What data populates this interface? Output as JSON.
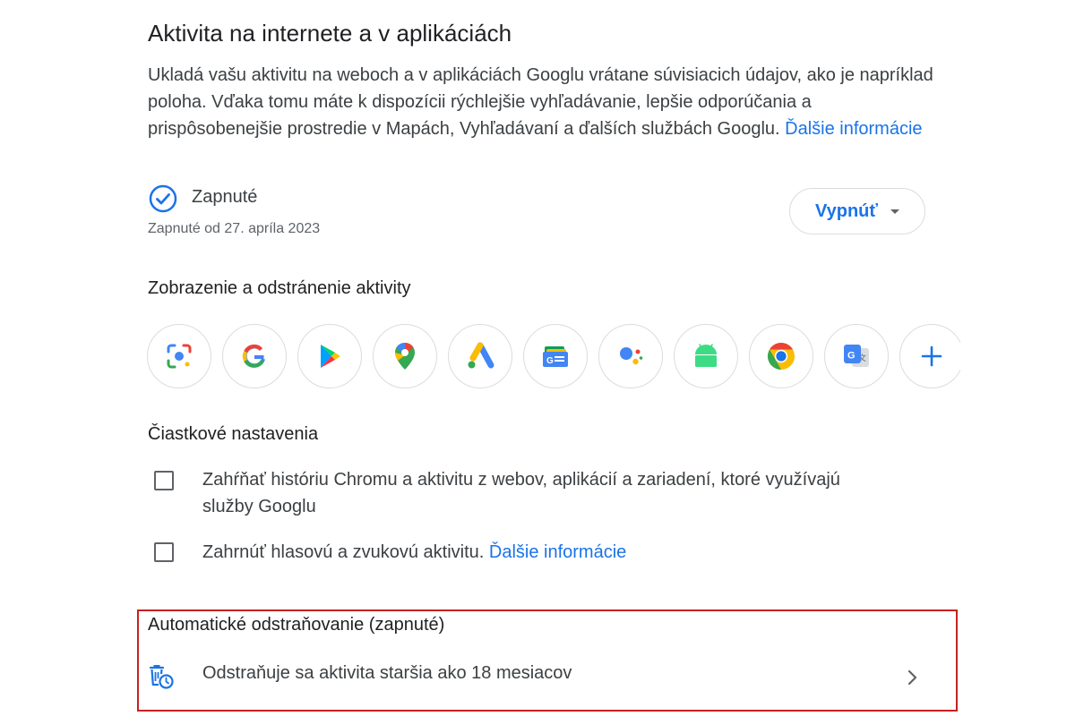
{
  "section": {
    "title": "Aktivita na internete a v aplikáciách",
    "description": "Ukladá vašu aktivitu na weboch a v aplikáciách Googlu vrátane súvisiacich údajov, ako je napríklad poloha. Vďaka tomu máte k dispozícii rýchlejšie vyhľadávanie, lepšie odporúčania a prispôsobenejšie prostredie v Mapách, Vyhľadávaní a ďalších službách Googlu.",
    "learn_more": "Ďalšie informácie"
  },
  "status": {
    "label": "Zapnuté",
    "since": "Zapnuté od 27. apríla 2023",
    "icon": "check-circle-icon",
    "toggle_label": "Vypnúť"
  },
  "activity": {
    "heading": "Zobrazenie a odstránenie aktivity",
    "apps": [
      {
        "name": "google-lens-icon"
      },
      {
        "name": "google-search-icon"
      },
      {
        "name": "google-play-icon"
      },
      {
        "name": "google-maps-icon"
      },
      {
        "name": "google-ads-icon"
      },
      {
        "name": "google-news-icon"
      },
      {
        "name": "google-assistant-icon"
      },
      {
        "name": "android-icon"
      },
      {
        "name": "chrome-icon"
      },
      {
        "name": "google-translate-icon"
      },
      {
        "name": "add-icon"
      }
    ]
  },
  "subsettings": {
    "heading": "Čiastkové nastavenia",
    "chrome_history": {
      "line1": "Zahŕňať históriu Chromu a aktivitu z webov, aplikácií a zariadení, ktoré využívajú",
      "line2": "služby Googlu",
      "checked": false
    },
    "voice_audio": {
      "label": "Zahrnúť hlasovú a zvukovú aktivitu.",
      "learn_more": "Ďalšie informácie",
      "checked": false
    }
  },
  "auto_delete": {
    "heading": "Automatické odstraňovanie (zapnuté)",
    "description": "Odstraňuje sa aktivita staršia ako 18 mesiacov",
    "icon": "auto-delete-icon",
    "highlight_color": "#c5221f"
  },
  "colors": {
    "accent": "#1a73e8",
    "text": "#202124",
    "secondary_text": "#5f6368",
    "border": "#dadce0"
  }
}
